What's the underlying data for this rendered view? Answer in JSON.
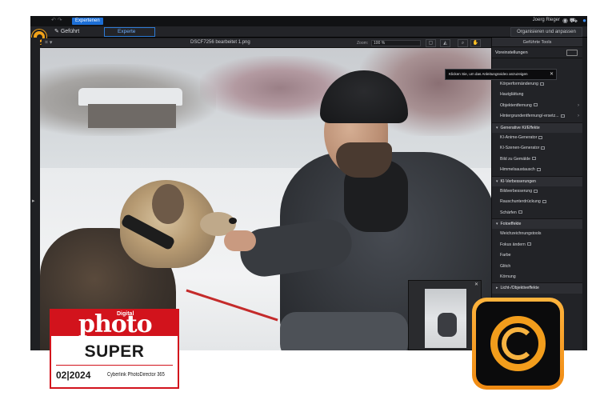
{
  "titlebar": {
    "mode_tag": "Expertenen",
    "user": "Joerg Rieger"
  },
  "modebar": {
    "guided": "Geführt",
    "expert": "Experte",
    "organize": "Organisieren und anpassen"
  },
  "toolbar": {
    "filename": "DSCF7256 bearbeitet 1.png",
    "zoom_label": "Zoom:",
    "zoom_value": "100 %"
  },
  "panel": {
    "title": "Geführte Tools",
    "presets": "Voreinstellungen",
    "tooltip": "Klicken Sie, um das Anleitungsvideo anzuzeigen",
    "items": [
      {
        "label": "Körperformänderung",
        "kind": "item",
        "icon": true
      },
      {
        "label": "Hautglättung",
        "kind": "item"
      },
      {
        "label": "Objektentfernung",
        "kind": "item",
        "icon": true,
        "chevron": true
      },
      {
        "label": "Hintergrundentfernung/-ersetz...",
        "kind": "item",
        "icon": true,
        "chevron": true
      },
      {
        "label": "Generative KI/Effekte",
        "kind": "section"
      },
      {
        "label": "KI-Anime-Generator",
        "kind": "item",
        "icon": true
      },
      {
        "label": "KI-Szenen-Generator",
        "kind": "item",
        "icon": true
      },
      {
        "label": "Bild zu Gemälde",
        "kind": "item",
        "icon": true
      },
      {
        "label": "Himmelsaustausch",
        "kind": "item",
        "icon": true
      },
      {
        "label": "KI-Verbesserungen",
        "kind": "section"
      },
      {
        "label": "Bildverbesserung",
        "kind": "item",
        "icon": true
      },
      {
        "label": "Rauschunterdrückung",
        "kind": "item",
        "icon": true
      },
      {
        "label": "Schärfen",
        "kind": "item",
        "icon": true
      },
      {
        "label": "Fotoeffekte",
        "kind": "section"
      },
      {
        "label": "Weichzeichnungstools",
        "kind": "item"
      },
      {
        "label": "Fokus ändern",
        "kind": "item",
        "icon": true
      },
      {
        "label": "Farbe",
        "kind": "item"
      },
      {
        "label": "Glitch",
        "kind": "item"
      },
      {
        "label": "Körnung",
        "kind": "item"
      },
      {
        "label": "Licht-/Objektiveffekte",
        "kind": "section-collapsed"
      }
    ]
  },
  "badge": {
    "digital": "Digital",
    "brand": "photo",
    "rating": "SUPER",
    "issue": "02|2024",
    "product": "Cyberlink PhotoDirector 365"
  },
  "colors": {
    "accent": "#1d6fd6",
    "badge_red": "#d2131c",
    "icon_orange": "#f29d1c"
  },
  "icons": {
    "app_logo": "photodirector-logo",
    "app_icon": "photodirector-app-icon"
  }
}
